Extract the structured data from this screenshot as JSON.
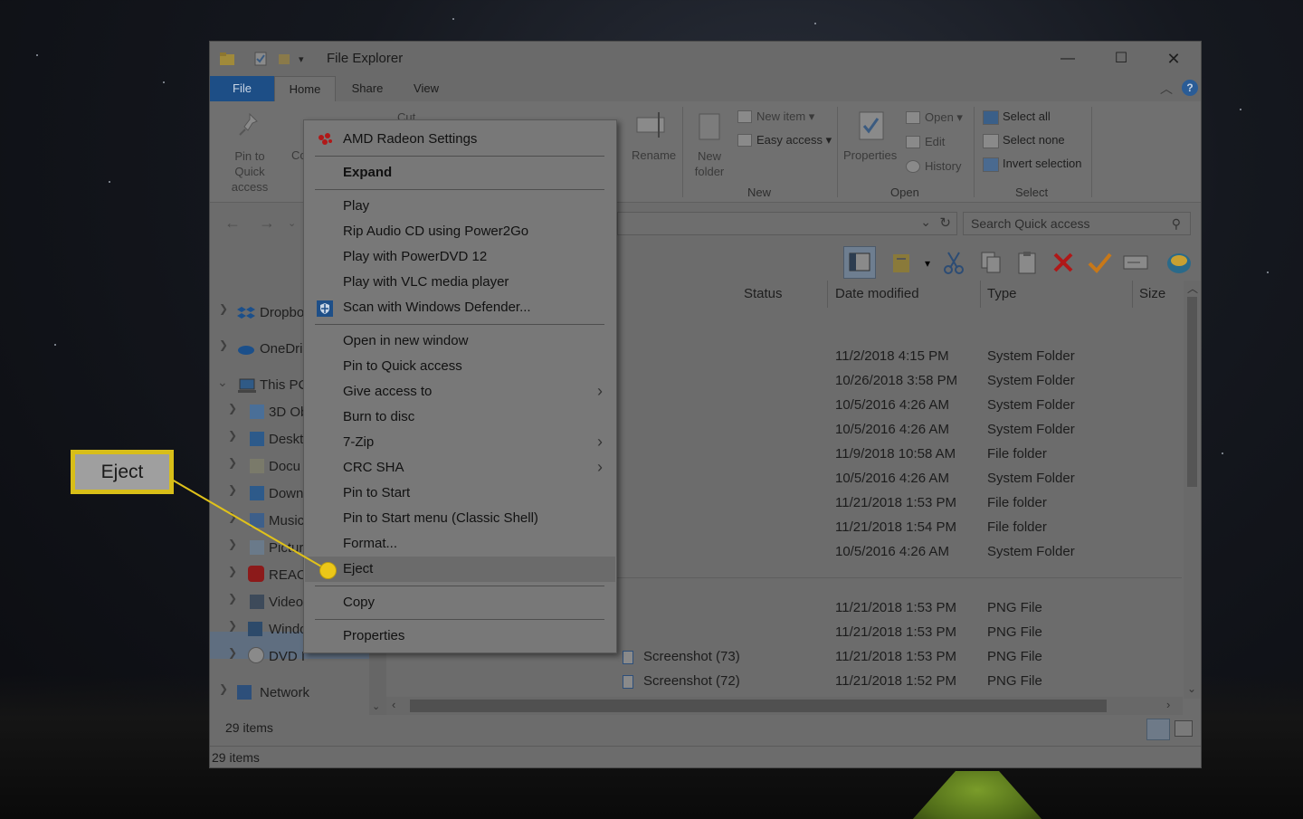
{
  "window": {
    "title": "File Explorer"
  },
  "ribbon_tabs": [
    "File",
    "Home",
    "Share",
    "View"
  ],
  "ribbon": {
    "pin_quick_access": "Pin to Quick access",
    "copy_partial": "Co",
    "cut": "Cut",
    "rename": "Rename",
    "new_folder": "New folder",
    "new_item": "New item",
    "easy_access": "Easy access",
    "group_new": "New",
    "properties": "Properties",
    "open": "Open",
    "edit": "Edit",
    "history": "History",
    "group_open": "Open",
    "select_all": "Select all",
    "select_none": "Select none",
    "invert_selection": "Invert selection",
    "group_select": "Select"
  },
  "search": {
    "placeholder": "Search Quick access"
  },
  "nav": {
    "items": [
      "Dropbo",
      "OneDri",
      "This PC",
      "3D Ob",
      "Deskt",
      "Docu",
      "Down",
      "Music",
      "Pictur",
      "REAC",
      "Video",
      "Windo",
      "DVD I",
      "Network"
    ]
  },
  "columns": {
    "status": "Status",
    "date_modified": "Date modified",
    "type": "Type",
    "size": "Size"
  },
  "rows": [
    {
      "date": "11/2/2018 4:15 PM",
      "type": "System Folder"
    },
    {
      "date": "10/26/2018 3:58 PM",
      "type": "System Folder"
    },
    {
      "date": "10/5/2016 4:26 AM",
      "type": "System Folder"
    },
    {
      "date": "10/5/2016 4:26 AM",
      "type": "System Folder"
    },
    {
      "date": "11/9/2018 10:58 AM",
      "type": "File folder"
    },
    {
      "date": "10/5/2016 4:26 AM",
      "type": "System Folder"
    },
    {
      "date": "11/21/2018 1:53 PM",
      "type": "File folder"
    },
    {
      "date": "11/21/2018 1:54 PM",
      "type": "File folder"
    },
    {
      "date": "10/5/2016 4:26 AM",
      "type": "System Folder"
    }
  ],
  "recent_rows": [
    {
      "name": "",
      "date": "11/21/2018 1:53 PM",
      "type": "PNG File"
    },
    {
      "name": "",
      "date": "11/21/2018 1:53 PM",
      "type": "PNG File"
    },
    {
      "name": "Screenshot (73)",
      "date": "11/21/2018 1:53 PM",
      "type": "PNG File"
    },
    {
      "name": "Screenshot (72)",
      "date": "11/21/2018 1:52 PM",
      "type": "PNG File"
    }
  ],
  "status": {
    "items_pane": "29 items",
    "items_bar": "29 items"
  },
  "context_menu": {
    "items": [
      "AMD Radeon Settings",
      "Expand",
      "Play",
      "Rip Audio CD using Power2Go",
      "Play with PowerDVD 12",
      "Play with VLC media player",
      "Scan with Windows Defender...",
      "Open in new window",
      "Pin to Quick access",
      "Give access to",
      "Burn to disc",
      "7-Zip",
      "CRC SHA",
      "Pin to Start",
      "Pin to Start menu (Classic Shell)",
      "Format...",
      "Eject",
      "Copy",
      "Properties"
    ]
  },
  "callout": {
    "label": "Eject"
  },
  "colors": {
    "file_tab": "#1d4e86",
    "callout_border": "#d8be18",
    "delete_red": "#b01818",
    "check_orange": "#c87818"
  }
}
